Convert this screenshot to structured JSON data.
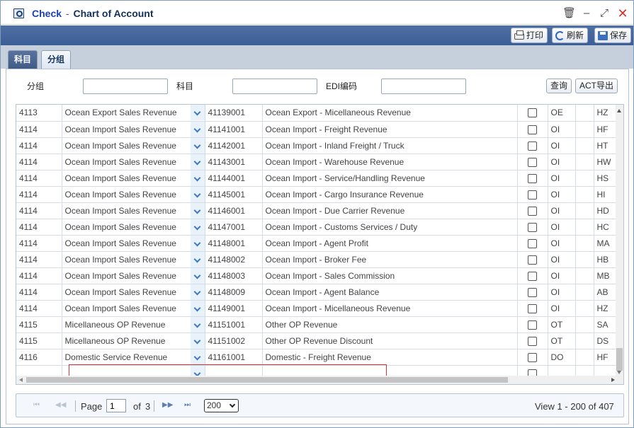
{
  "window": {
    "title_strong": "Check",
    "title_sep": "-",
    "title_rest": "Chart of Account"
  },
  "toolbar": {
    "print_label": "打印",
    "refresh_label": "刷新",
    "save_label": "保存"
  },
  "tabs": [
    {
      "label": "科目",
      "active": true
    },
    {
      "label": "分组",
      "active": false
    }
  ],
  "filters": {
    "group_label": "分组",
    "group_value": "",
    "account_label": "科目",
    "account_value": "",
    "edi_label": "EDI编码",
    "edi_value": "",
    "query_button": "查询",
    "export_button": "ACT导出"
  },
  "grid": {
    "rows": [
      {
        "group": "4113",
        "group_name": "Ocean Export Sales Revenue",
        "account": "41139001",
        "account_name": "Ocean Export - Micellaneous Revenue",
        "checked": false,
        "code": "OE",
        "edi": "HZ"
      },
      {
        "group": "4114",
        "group_name": "Ocean Import Sales Revenue",
        "account": "41141001",
        "account_name": "Ocean Import - Freight Revenue",
        "checked": false,
        "code": "OI",
        "edi": "HF"
      },
      {
        "group": "4114",
        "group_name": "Ocean Import Sales Revenue",
        "account": "41142001",
        "account_name": "Ocean Import - Inland Freight / Truck",
        "checked": false,
        "code": "OI",
        "edi": "HT"
      },
      {
        "group": "4114",
        "group_name": "Ocean Import Sales Revenue",
        "account": "41143001",
        "account_name": "Ocean Import - Warehouse Revenue",
        "checked": false,
        "code": "OI",
        "edi": "HW"
      },
      {
        "group": "4114",
        "group_name": "Ocean Import Sales Revenue",
        "account": "41144001",
        "account_name": "Ocean Import - Service/Handling Revenue",
        "checked": false,
        "code": "OI",
        "edi": "HS"
      },
      {
        "group": "4114",
        "group_name": "Ocean Import Sales Revenue",
        "account": "41145001",
        "account_name": "Ocean Import - Cargo Insurance Revenue",
        "checked": false,
        "code": "OI",
        "edi": "HI"
      },
      {
        "group": "4114",
        "group_name": "Ocean Import Sales Revenue",
        "account": "41146001",
        "account_name": "Ocean Import - Due Carrier Revenue",
        "checked": false,
        "code": "OI",
        "edi": "HD"
      },
      {
        "group": "4114",
        "group_name": "Ocean Import Sales Revenue",
        "account": "41147001",
        "account_name": "Ocean Import - Customs Services / Duty",
        "checked": false,
        "code": "OI",
        "edi": "HC"
      },
      {
        "group": "4114",
        "group_name": "Ocean Import Sales Revenue",
        "account": "41148001",
        "account_name": "Ocean Import - Agent Profit",
        "checked": false,
        "code": "OI",
        "edi": "MA"
      },
      {
        "group": "4114",
        "group_name": "Ocean Import Sales Revenue",
        "account": "41148002",
        "account_name": "Ocean Import - Broker Fee",
        "checked": false,
        "code": "OI",
        "edi": "HB"
      },
      {
        "group": "4114",
        "group_name": "Ocean Import Sales Revenue",
        "account": "41148003",
        "account_name": "Ocean Import - Sales Commission",
        "checked": false,
        "code": "OI",
        "edi": "MB"
      },
      {
        "group": "4114",
        "group_name": "Ocean Import Sales Revenue",
        "account": "41148009",
        "account_name": "Ocean Import - Agent Balance",
        "checked": false,
        "code": "OI",
        "edi": "AB"
      },
      {
        "group": "4114",
        "group_name": "Ocean Import Sales Revenue",
        "account": "41149001",
        "account_name": "Ocean Import - Micellaneous Revenue",
        "checked": false,
        "code": "OI",
        "edi": "HZ"
      },
      {
        "group": "4115",
        "group_name": "Micellaneous OP Revenue",
        "account": "41151001",
        "account_name": "Other OP Revenue",
        "checked": false,
        "code": "OT",
        "edi": "SA"
      },
      {
        "group": "4115",
        "group_name": "Micellaneous OP Revenue",
        "account": "41151002",
        "account_name": "Other OP Revenue Discount",
        "checked": false,
        "code": "OT",
        "edi": "DS"
      },
      {
        "group": "4116",
        "group_name": "Domestic Service Revenue",
        "account": "41161001",
        "account_name": "Domestic - Freight Revenue",
        "checked": false,
        "code": "DO",
        "edi": "HF"
      },
      {
        "group": "",
        "group_name": "",
        "account": "",
        "account_name": "",
        "checked": false,
        "code": "",
        "edi": ""
      }
    ]
  },
  "pager": {
    "page_label": "Page",
    "page_value": "1",
    "of_label": "of",
    "total_pages": "3",
    "page_size": "200",
    "view_text": "View 1 - 200 of 407"
  },
  "colors": {
    "toolbar": "#3b5e96",
    "title": "#14305c",
    "title_strong": "#1c3fb8",
    "editing_border": "#d8343b",
    "close_icon": "#d4302b"
  }
}
